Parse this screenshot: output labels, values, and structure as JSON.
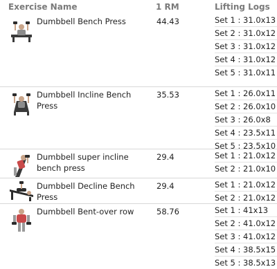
{
  "header": {
    "name": "Exercise Name",
    "rm": "1 RM",
    "logs": "Lifting Logs"
  },
  "rows": [
    {
      "name": "Dumbbell Bench Press",
      "rm": "44.43",
      "icon": "bench-press-figure-icon",
      "sets": [
        "Set 1 : 31.0x13",
        "Set 2 : 31.0x12",
        "Set 3 : 31.0x12",
        "Set 4 : 31.0x12",
        "Set 5 : 31.0x11"
      ]
    },
    {
      "name": "Dumbbell Incline Bench Press",
      "rm": "35.53",
      "icon": "incline-bench-press-figure-icon",
      "sets": [
        "Set 1 : 26.0x11",
        "Set 2 : 26.0x10",
        "Set 3 : 26.0x8",
        "Set 4 : 23.5x11",
        "Set 5 : 23.5x10"
      ]
    },
    {
      "name": "Dumbbell super incline bench press",
      "rm": "29.4",
      "icon": "super-incline-figure-icon",
      "sets": [
        "Set 1 : 21.0x12",
        "Set 2 : 21.0x10"
      ]
    },
    {
      "name": "Dumbbell Decline Bench Press",
      "rm": "29.4",
      "icon": "decline-bench-press-figure-icon",
      "sets": [
        "Set 1 : 21.0x12",
        "Set 2 : 21.0x12"
      ]
    },
    {
      "name": "Dumbbell Bent-over row",
      "rm": "58.76",
      "icon": "bent-over-row-figure-icon",
      "sets": [
        "Set 1 : 41x13",
        "Set 2 : 41.0x12",
        "Set 3 : 41.0x12",
        "Set 4 : 38.5x15",
        "Set 5 : 38.5x13"
      ]
    }
  ]
}
